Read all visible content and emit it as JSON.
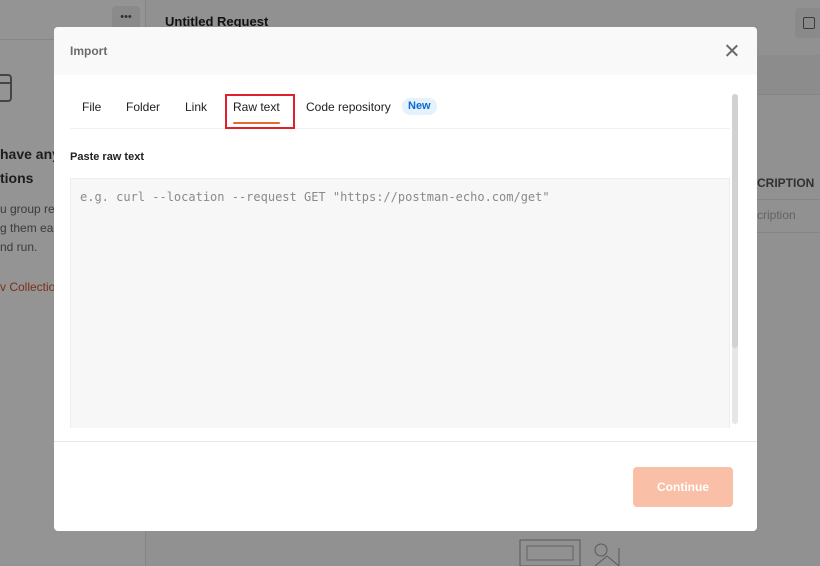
{
  "background": {
    "sidebar_more_label": "•••",
    "empty_state": {
      "heading_line1": "have any",
      "heading_line2": "tions",
      "desc_line1": "u group re",
      "desc_line2": "g them eas",
      "desc_line3": "nd run.",
      "create_link": "v Collection"
    },
    "request_title": "Untitled Request",
    "description_header": "CRIPTION",
    "description_placeholder": "cription"
  },
  "modal": {
    "title": "Import",
    "close_icon": "close-icon",
    "tabs": [
      {
        "label": "File",
        "active": false
      },
      {
        "label": "Folder",
        "active": false
      },
      {
        "label": "Link",
        "active": false
      },
      {
        "label": "Raw text",
        "active": true
      },
      {
        "label": "Code repository",
        "active": false,
        "badge": "New"
      }
    ],
    "raw_text": {
      "label": "Paste raw text",
      "value": "",
      "placeholder": "e.g. curl --location --request GET \"https://postman-echo.com/get\""
    },
    "continue_label": "Continue",
    "continue_enabled": false,
    "colors": {
      "accent": "#e8692f",
      "continue_disabled": "#f9bfa7",
      "badge_bg": "#e5f2fb",
      "badge_text": "#0b6ad0",
      "highlight_box": "#e0202a"
    }
  }
}
